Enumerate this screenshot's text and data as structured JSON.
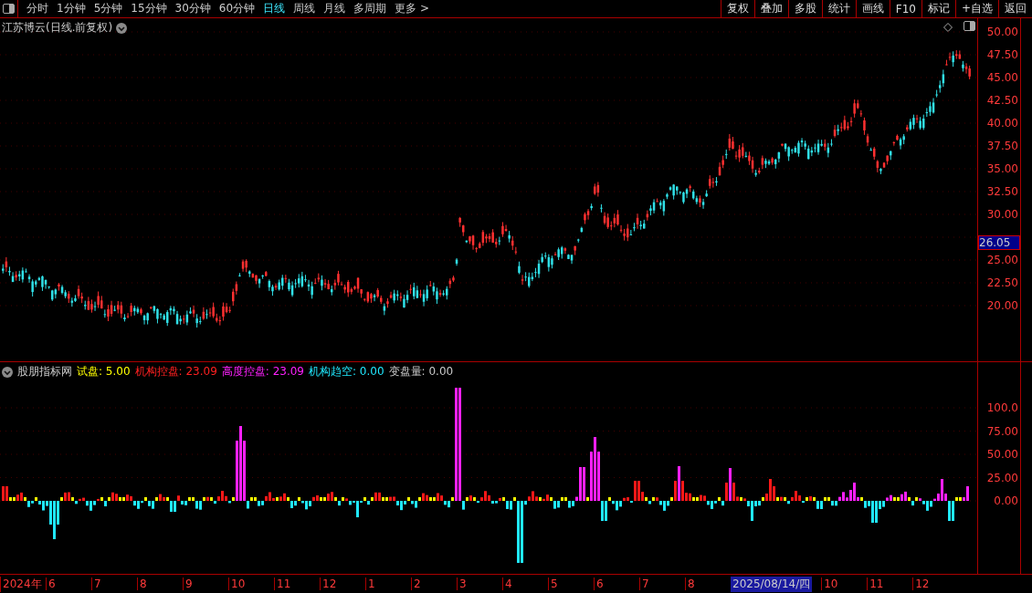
{
  "toolbar": {
    "periods": [
      {
        "label": "分时",
        "selected": false
      },
      {
        "label": "1分钟",
        "selected": false
      },
      {
        "label": "5分钟",
        "selected": false
      },
      {
        "label": "15分钟",
        "selected": false
      },
      {
        "label": "30分钟",
        "selected": false
      },
      {
        "label": "60分钟",
        "selected": false
      },
      {
        "label": "日线",
        "selected": true
      },
      {
        "label": "周线",
        "selected": false
      },
      {
        "label": "月线",
        "selected": false
      },
      {
        "label": "多周期",
        "selected": false
      },
      {
        "label": "更多 >",
        "selected": false
      }
    ],
    "buttons": [
      "复权",
      "叠加",
      "多股",
      "统计",
      "画线",
      "F10",
      "标记",
      "+自选",
      "返回"
    ]
  },
  "main_chart": {
    "title": "江苏博云(日线.前复权)",
    "price_ticks": [
      "50.00",
      "47.50",
      "45.00",
      "42.50",
      "40.00",
      "37.50",
      "35.00",
      "32.50",
      "30.00",
      "25.00",
      "22.50",
      "20.00"
    ],
    "current_price": "26.05"
  },
  "indicator": {
    "name": "股朋指标网",
    "values": [
      {
        "text": "试盘: 5.00",
        "color": "#ffff00"
      },
      {
        "text": "机构控盘: 23.09",
        "color": "#ff2020"
      },
      {
        "text": "高度控盘: 23.09",
        "color": "#ff20ff"
      },
      {
        "text": "机构趋空: 0.00",
        "color": "#20e8ff"
      },
      {
        "text": "变盘量: 0.00",
        "color": "#c8c8c8"
      }
    ],
    "ticks": [
      "100.0",
      "75.00",
      "50.00",
      "25.00",
      "0.00"
    ]
  },
  "time_axis": {
    "labels": [
      "2024年",
      "6",
      "7",
      "8",
      "9",
      "10",
      "11",
      "12",
      "1",
      "2",
      "3",
      "4",
      "5",
      "6",
      "7",
      "8"
    ],
    "crosshair_date": "2025/08/14/四",
    "labels_after": [
      "10",
      "11",
      "12"
    ]
  }
}
